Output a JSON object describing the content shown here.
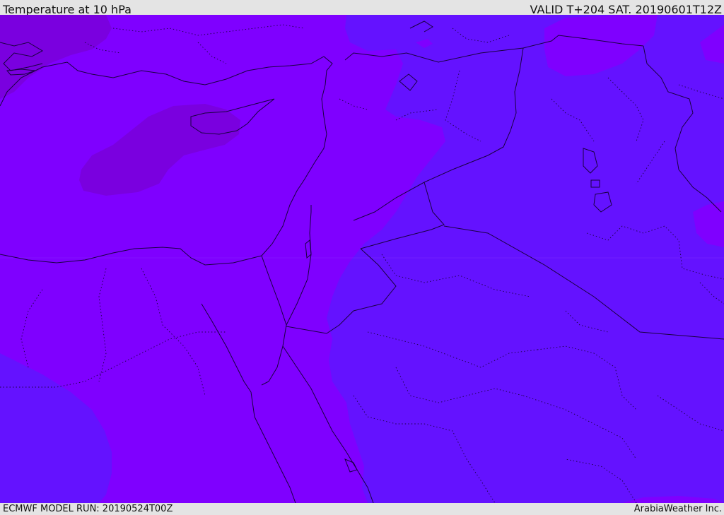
{
  "header": {
    "title": "Temperature at 10 hPa",
    "valid_time": "VALID T+204 SAT. 20190601T12Z"
  },
  "footer": {
    "model_run": "ECMWF MODEL RUN: 20190524T00Z",
    "credit": "ArabiaWeather Inc."
  },
  "map": {
    "field": "temperature",
    "level": "10 hPa",
    "colors": {
      "warm_violet": "#7f00ff",
      "dark_violet": "#7a00df",
      "cool_blue_violet": "#6412ff",
      "border_line": "#1a0040"
    }
  }
}
